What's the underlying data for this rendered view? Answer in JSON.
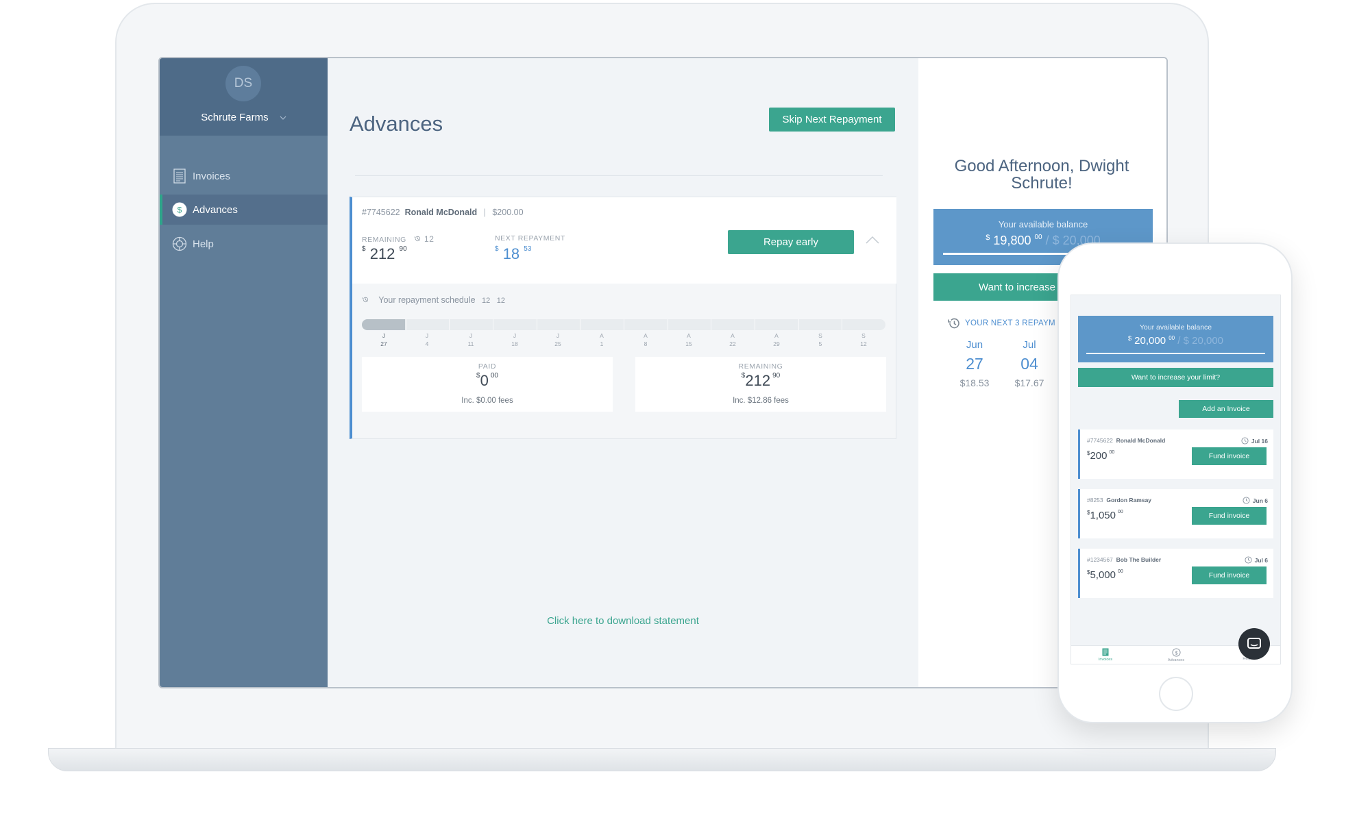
{
  "sidebar": {
    "avatar_initials": "DS",
    "org_name": "Schrute Farms",
    "items": [
      {
        "label": "Invoices",
        "icon": "invoice-icon"
      },
      {
        "label": "Advances",
        "icon": "dollar-icon"
      },
      {
        "label": "Help",
        "icon": "lifebuoy-icon"
      }
    ]
  },
  "main": {
    "title": "Advances",
    "skip_label": "Skip Next Repayment",
    "advance": {
      "ref_number": "#7745622",
      "customer": "Ronald McDonald",
      "separator": "|",
      "amount": "$200.00",
      "remaining_label": "REMAINING",
      "remaining_count": "12",
      "remaining_currency": "$",
      "remaining_whole": "212",
      "remaining_cents": "90",
      "next_label": "NEXT REPAYMENT",
      "next_currency": "$",
      "next_whole": "18",
      "next_cents": "53",
      "repay_label": "Repay early",
      "schedule_label": "Your repayment schedule",
      "schedule_paid": "12",
      "schedule_total": "12",
      "progress_fraction": 0.083,
      "ticks": [
        {
          "m": "J",
          "d": "27"
        },
        {
          "m": "J",
          "d": "4"
        },
        {
          "m": "J",
          "d": "11"
        },
        {
          "m": "J",
          "d": "18"
        },
        {
          "m": "J",
          "d": "25"
        },
        {
          "m": "A",
          "d": "1"
        },
        {
          "m": "A",
          "d": "8"
        },
        {
          "m": "A",
          "d": "15"
        },
        {
          "m": "A",
          "d": "22"
        },
        {
          "m": "A",
          "d": "29"
        },
        {
          "m": "S",
          "d": "5"
        },
        {
          "m": "S",
          "d": "12"
        }
      ],
      "paid": {
        "label": "PAID",
        "currency": "$",
        "whole": "0",
        "cents": "00",
        "fees": "Inc. $0.00 fees"
      },
      "remaining": {
        "label": "REMAINING",
        "currency": "$",
        "whole": "212",
        "cents": "90",
        "fees": "Inc. $12.86 fees"
      }
    },
    "download_label": "Click here to download statement"
  },
  "right": {
    "greeting": "Good Afternoon, Dwight Schrute!",
    "balance_label": "Your available balance",
    "balance_currency": "$",
    "balance_whole": "19,800",
    "balance_cents": "00",
    "balance_limit": "/ $ 20,000",
    "increase_label": "Want to increase",
    "next_label": "YOUR NEXT 3 REPAYM",
    "repayments": [
      {
        "month": "Jun",
        "day": "27",
        "amount": "$18.53"
      },
      {
        "month": "Jul",
        "day": "04",
        "amount": "$17.67"
      }
    ]
  },
  "phone": {
    "balance_label": "Your available balance",
    "balance_currency": "$",
    "balance_whole": "20,000",
    "balance_cents": "00",
    "balance_limit": "/ $ 20,000",
    "increase_label": "Want to increase your limit?",
    "add_invoice_label": "Add an Invoice",
    "invoices": [
      {
        "ref": "#7745622",
        "name": "Ronald McDonald",
        "due": "Jul 16",
        "currency": "$",
        "whole": "200",
        "cents": "00",
        "action": "Fund invoice"
      },
      {
        "ref": "#8253",
        "name": "Gordon Ramsay",
        "due": "Jun 6",
        "currency": "$",
        "whole": "1,050",
        "cents": "00",
        "action": "Fund invoice"
      },
      {
        "ref": "#1234567",
        "name": "Bob The Builder",
        "due": "Jul 6",
        "currency": "$",
        "whole": "5,000",
        "cents": "00",
        "action": "Fund invoice"
      }
    ],
    "tabs": [
      {
        "label": "Invoices"
      },
      {
        "label": "Advances"
      },
      {
        "label": "Help"
      }
    ]
  },
  "colors": {
    "accent": "#3ba58f",
    "sidebar": "#607d98",
    "balance_card": "#5d97c9",
    "link_blue": "#4d8ed0"
  }
}
